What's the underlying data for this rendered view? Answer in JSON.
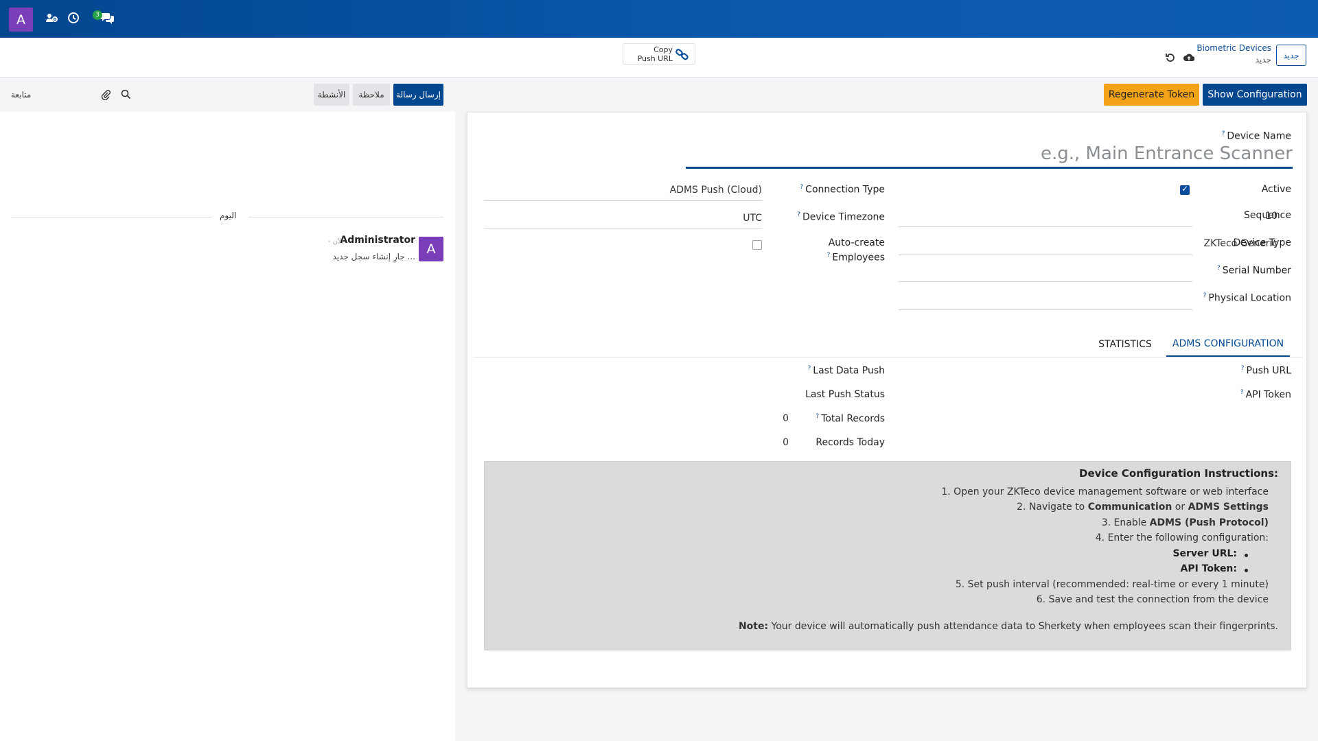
{
  "navbar": {
    "avatar_letter": "A",
    "icons": [
      "users-cog-icon",
      "clock-icon",
      "chat-icon"
    ],
    "chat_badge": "3",
    "colors": {
      "navbar": "#03478f",
      "avatar": "#7a3fb8",
      "badge": "#25a148"
    }
  },
  "control": {
    "new_label": "جديد",
    "breadcrumb_parent": "Biometric Devices",
    "breadcrumb_current": "جديد",
    "copy_button": {
      "line1": "Copy",
      "line2": "Push URL"
    }
  },
  "actions": {
    "show_config": "Show Configuration",
    "regenerate_token": "Regenerate Token",
    "colors": {
      "primary": "#03478f",
      "warning": "#f5a316"
    }
  },
  "form": {
    "device_name": {
      "label": "Device Name",
      "placeholder": "e.g., Main Entrance Scanner",
      "value": ""
    },
    "active": {
      "label": "Active",
      "checked": true
    },
    "sequence": {
      "label": "Sequence",
      "value": "10"
    },
    "device_type": {
      "label": "Device Type",
      "value": "ZKTeco Generic"
    },
    "serial_number": {
      "label": "Serial Number",
      "value": ""
    },
    "physical_location": {
      "label": "Physical Location",
      "value": ""
    },
    "connection_type": {
      "label": "Connection Type",
      "value": "ADMS Push (Cloud)"
    },
    "device_timezone": {
      "label": "Device Timezone",
      "value": "UTC"
    },
    "auto_create": {
      "label_line1": "Auto-create",
      "label_line2": "Employees",
      "checked": false
    }
  },
  "tabs": [
    {
      "label": "ADMS CONFIGURATION",
      "active": true
    },
    {
      "label": "STATISTICS",
      "active": false
    }
  ],
  "adms": {
    "push_url": {
      "label": "Push URL",
      "value": ""
    },
    "api_token": {
      "label": "API Token",
      "value": ""
    },
    "last_data_push": {
      "label": "Last Data Push",
      "value": ""
    },
    "last_push_status": {
      "label": "Last Push Status",
      "value": ""
    },
    "total_records": {
      "label": "Total Records",
      "value": "0"
    },
    "records_today": {
      "label": "Records Today",
      "value": "0"
    }
  },
  "instructions": {
    "title": "Device Configuration Instructions:",
    "step1": "1. Open your ZKTeco device management software or web interface",
    "step2_pre": "2. Navigate to ",
    "step2_b1": "Communication",
    "step2_mid": " or ",
    "step2_b2": "ADMS Settings",
    "step3_pre": "3. Enable ",
    "step3_b": "ADMS (Push Protocol)",
    "step4": "4. Enter the following configuration:",
    "bullet1": "Server URL:",
    "bullet2": "API Token:",
    "step5": "5. Set push interval (recommended: real-time or every 1 minute)",
    "step6": "6. Save and test the connection from the device",
    "note_label": "Note:",
    "note_text": " Your device will automatically push attendance data to Sherkety when employees scan their fingerprints."
  },
  "chatter": {
    "send_message": "إرسال رسالة",
    "log_note": "ملاحظة",
    "activities": "الأنشطة",
    "follow": "متابعة",
    "today": "اليوم",
    "message": {
      "avatar_letter": "A",
      "author": "Administrator",
      "time": "- الآن",
      "body": "جارِ إنشاء سجل جديد ..."
    }
  }
}
